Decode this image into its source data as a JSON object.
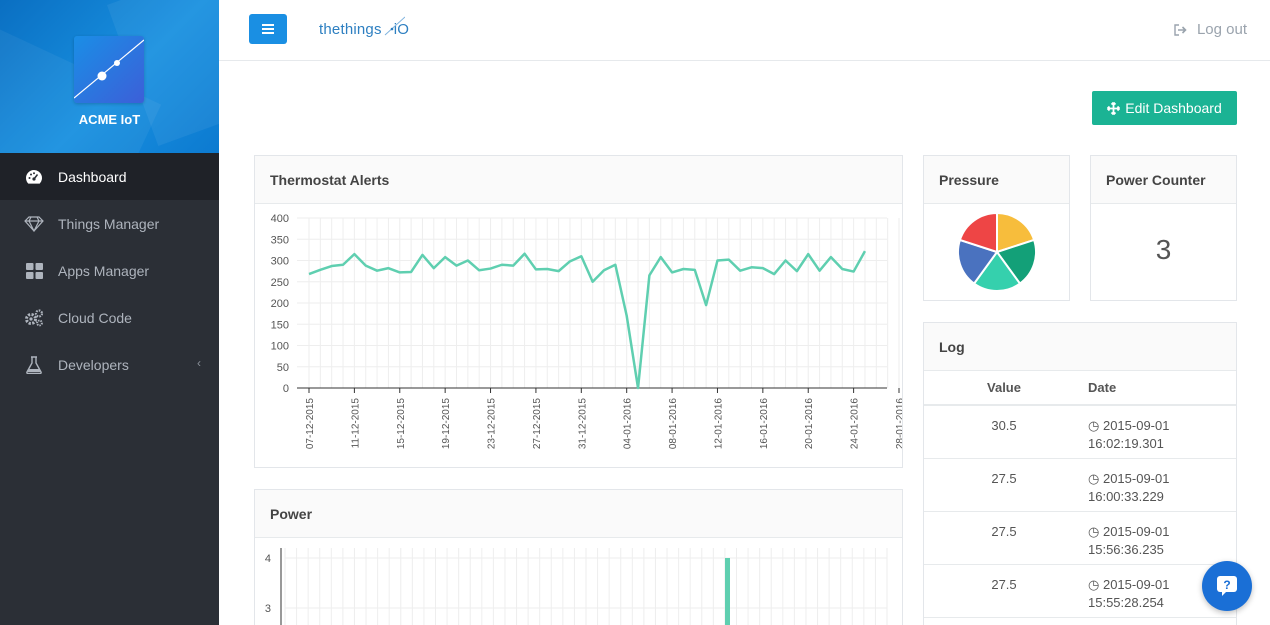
{
  "sidebar": {
    "brand_name": "ACME IoT",
    "items": [
      {
        "label": "Dashboard",
        "icon": "dashboard-gauge-icon",
        "active": true
      },
      {
        "label": "Things Manager",
        "icon": "diamond-icon",
        "active": false
      },
      {
        "label": "Apps Manager",
        "icon": "grid-icon",
        "active": false
      },
      {
        "label": "Cloud Code",
        "icon": "gears-icon",
        "active": false
      },
      {
        "label": "Developers",
        "icon": "flask-icon",
        "active": false,
        "has_submenu": true
      }
    ]
  },
  "topbar": {
    "logo_text": "thethings",
    "logo_suffix": "iO",
    "logout_label": "Log out"
  },
  "edit_dashboard_label": "Edit Dashboard",
  "widgets": {
    "thermostat": {
      "title": "Thermostat Alerts"
    },
    "pressure": {
      "title": "Pressure"
    },
    "counter": {
      "title": "Power Counter",
      "value": "3"
    },
    "log": {
      "title": "Log",
      "headers": {
        "value": "Value",
        "date": "Date"
      },
      "rows": [
        {
          "value": "30.5",
          "date": "2015-09-01",
          "time": "16:02:19.301"
        },
        {
          "value": "27.5",
          "date": "2015-09-01",
          "time": "16:00:33.229"
        },
        {
          "value": "27.5",
          "date": "2015-09-01",
          "time": "15:56:36.235"
        },
        {
          "value": "27.5",
          "date": "2015-09-01",
          "time": "15:55:28.254"
        }
      ]
    },
    "power": {
      "title": "Power"
    }
  },
  "colors": {
    "accent_blue": "#1a8fe3",
    "edit_green": "#1bb394",
    "line_teal": "#5fcfb0",
    "sidebar_bg": "#2b2f36"
  },
  "chart_data": [
    {
      "type": "line",
      "title": "Thermostat Alerts",
      "ylim": [
        0,
        400
      ],
      "yticks": [
        0,
        50,
        100,
        150,
        200,
        250,
        300,
        350,
        400
      ],
      "xticks": [
        "07-12-2015",
        "11-12-2015",
        "15-12-2015",
        "19-12-2015",
        "23-12-2015",
        "27-12-2015",
        "31-12-2015",
        "04-01-2016",
        "08-01-2016",
        "12-01-2016",
        "16-01-2016",
        "20-01-2016",
        "24-01-2016",
        "28-01-2016"
      ],
      "x_start": "07-12-2015",
      "x_step_days": 1,
      "values": [
        268,
        278,
        287,
        290,
        315,
        288,
        276,
        282,
        272,
        273,
        313,
        282,
        308,
        288,
        300,
        277,
        281,
        290,
        288,
        316,
        279,
        280,
        275,
        298,
        310,
        250,
        277,
        290,
        170,
        0,
        265,
        308,
        272,
        280,
        278,
        195,
        300,
        302,
        276,
        284,
        282,
        268,
        300,
        275,
        315,
        276,
        308,
        280,
        274,
        322
      ],
      "grid": true
    },
    {
      "type": "bar",
      "title": "Power",
      "yticks_visible": [
        3,
        4
      ],
      "note_visible": "single tall bar visible near 2016-01",
      "grid": true
    },
    {
      "type": "pie",
      "title": "Pressure",
      "slices": [
        {
          "value": 20,
          "color": "#f7bd3c"
        },
        {
          "value": 20,
          "color": "#13a078"
        },
        {
          "value": 20,
          "color": "#35d0ad"
        },
        {
          "value": 20,
          "color": "#4a72bf"
        },
        {
          "value": 20,
          "color": "#ee4545"
        }
      ]
    }
  ]
}
